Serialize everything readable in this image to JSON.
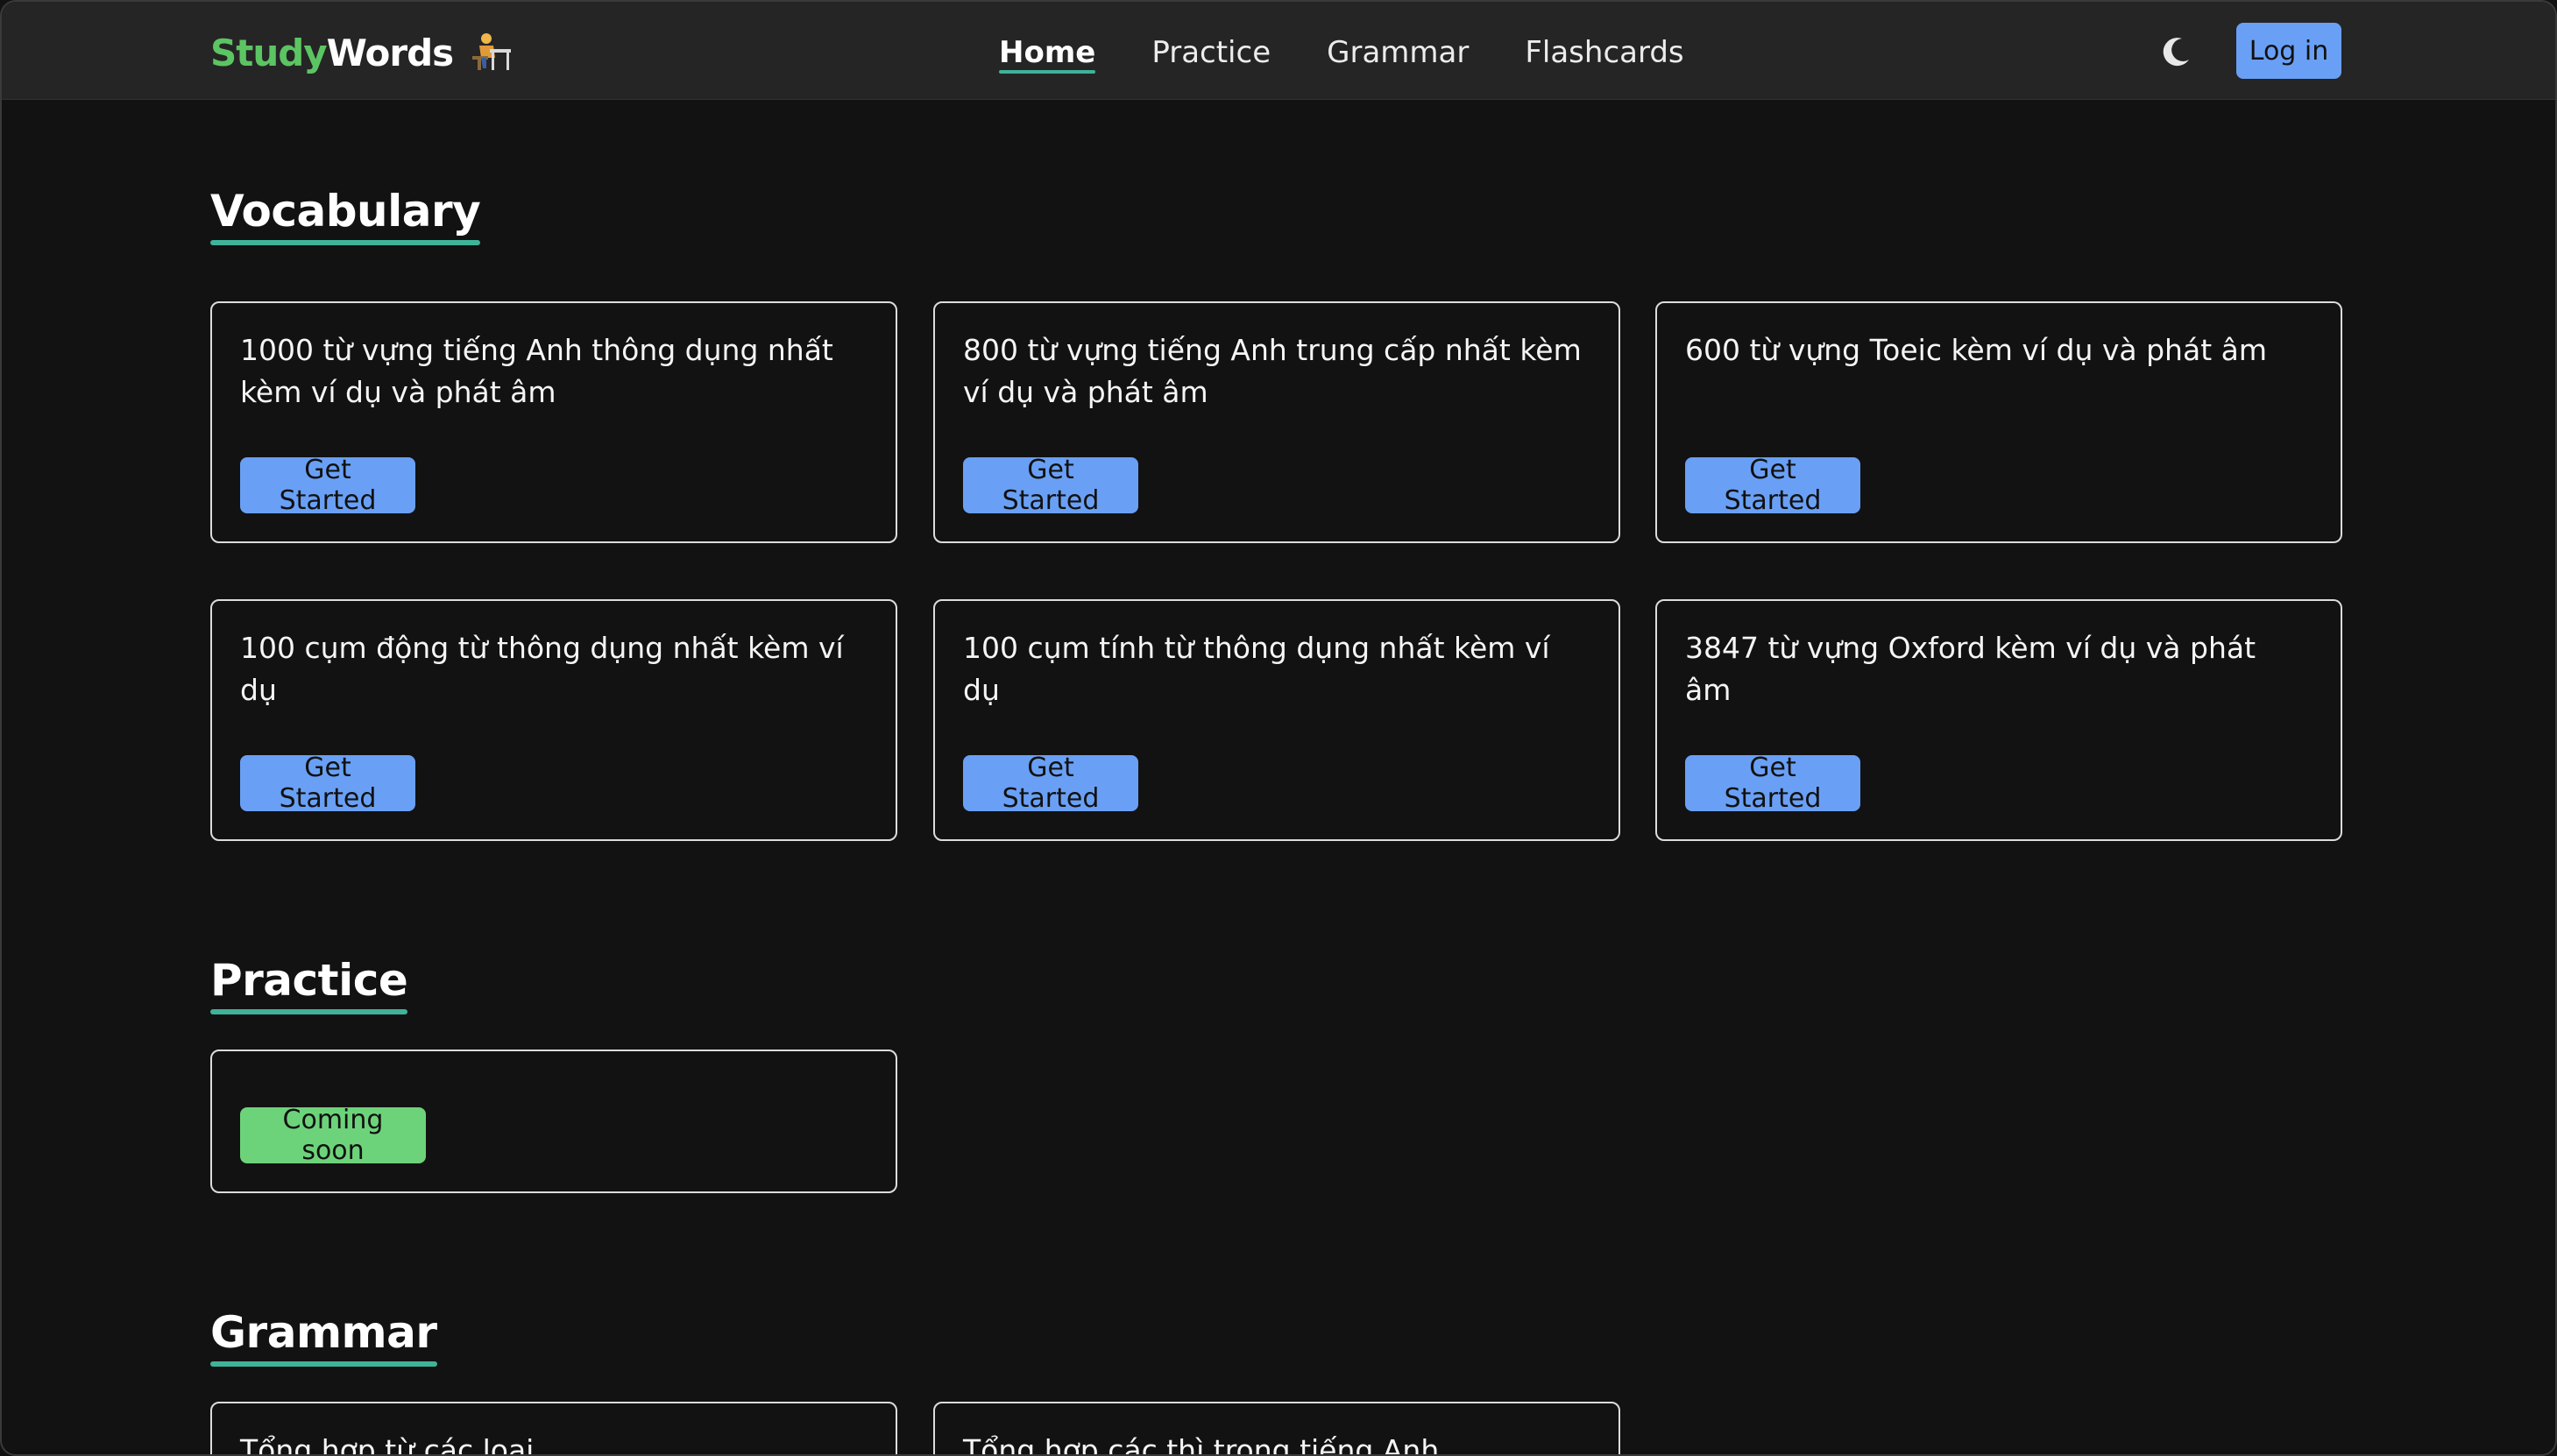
{
  "header": {
    "logo_part1": "Study",
    "logo_part2": "Words",
    "logo_icon": "person-at-desk-icon",
    "nav": [
      "Home",
      "Practice",
      "Grammar",
      "Flashcards"
    ],
    "active_nav": "Home",
    "theme_icon": "moon-icon",
    "login_label": "Log in"
  },
  "vocabulary": {
    "title": "Vocabulary",
    "cards": [
      {
        "text": "1000 từ vựng tiếng Anh thông dụng nhất kèm ví dụ và phát âm",
        "button": "Get Started"
      },
      {
        "text": "800 từ vựng tiếng Anh trung cấp nhất kèm ví dụ và phát âm",
        "button": "Get Started"
      },
      {
        "text": "600 từ vựng Toeic kèm ví dụ và phát âm",
        "button": "Get Started"
      },
      {
        "text": "100 cụm động từ thông dụng nhất kèm ví dụ",
        "button": "Get Started"
      },
      {
        "text": "100 cụm tính từ thông dụng nhất kèm ví dụ",
        "button": "Get Started"
      },
      {
        "text": "3847 từ vựng Oxford kèm ví dụ và phát âm",
        "button": "Get Started"
      }
    ]
  },
  "practice": {
    "title": "Practice",
    "cards": [
      {
        "text": "",
        "button": "Coming soon"
      }
    ]
  },
  "grammar": {
    "title": "Grammar",
    "cards": [
      {
        "text": "Tổng hợp từ các loại"
      },
      {
        "text": "Tổng hợp các thì trong tiếng Anh"
      }
    ]
  },
  "colors": {
    "background": "#121212",
    "navbar": "#252525",
    "accent_underline": "#3fb39a",
    "button_blue": "#69a0f5",
    "button_green": "#6dd37a",
    "logo_green": "#5cc563"
  }
}
